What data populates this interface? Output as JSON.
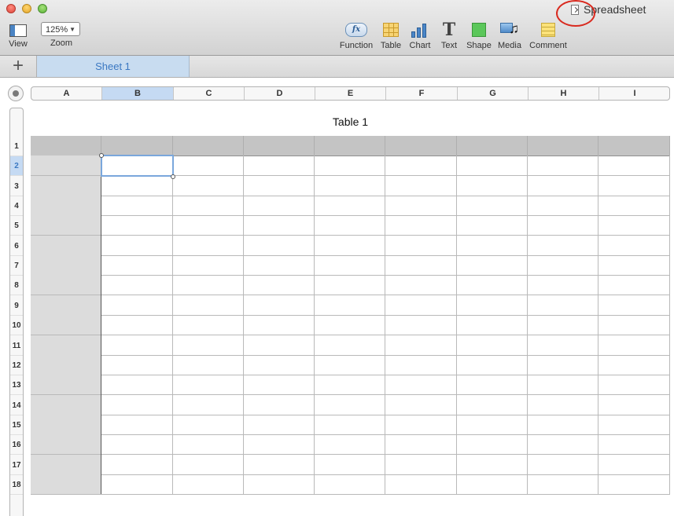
{
  "window": {
    "title": "Spreadsheet"
  },
  "toolbar": {
    "view_label": "View",
    "zoom_label": "Zoom",
    "zoom_value": "125%",
    "function_label": "Function",
    "function_icon_text": "fx",
    "table_label": "Table",
    "chart_label": "Chart",
    "text_label": "Text",
    "text_icon_glyph": "T",
    "shape_label": "Shape",
    "media_label": "Media",
    "comment_label": "Comment"
  },
  "sheets": {
    "add_glyph": "+",
    "tabs": [
      {
        "label": "Sheet 1",
        "active": true
      }
    ]
  },
  "table": {
    "title": "Table 1",
    "columns": [
      "A",
      "B",
      "C",
      "D",
      "E",
      "F",
      "G",
      "H",
      "I"
    ],
    "rows": [
      "1",
      "2",
      "3",
      "4",
      "5",
      "6",
      "7",
      "8",
      "9",
      "10",
      "11",
      "12",
      "13",
      "14",
      "15",
      "16",
      "17",
      "18"
    ],
    "selected_column": "B",
    "selected_row": "2",
    "header_rows": 1,
    "header_columns": 1
  },
  "colors": {
    "selection": "#7aa7dc",
    "sheet_tab_text": "#3b78c2",
    "annotation_circle": "#d92a1f"
  },
  "icons": {
    "view": "view-icon",
    "function": "function-icon",
    "table": "table-icon",
    "chart": "chart-icon",
    "text": "text-icon",
    "shape": "shape-icon",
    "media": "media-icon",
    "comment": "comment-icon"
  }
}
